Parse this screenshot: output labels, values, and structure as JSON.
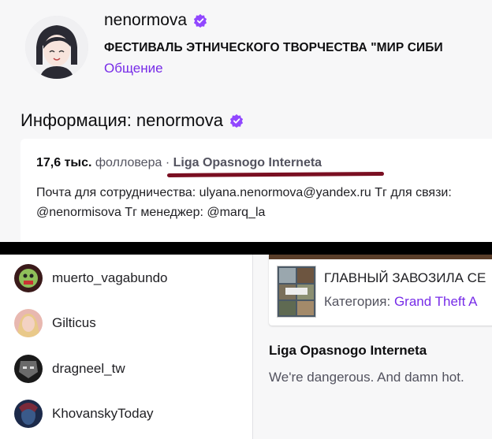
{
  "header": {
    "channel_name": "nenormova",
    "stream_title": "ФЕСТИВАЛЬ ЭТНИЧЕСКОГО ТВОРЧЕСТВА \"МИР СИБИ",
    "category": "Общение",
    "verified_color": "#9147ff"
  },
  "about": {
    "heading": "Информация: nenormova",
    "followers_count": "17,6 тыс.",
    "followers_label": "фолловера",
    "dot": "·",
    "team": "Liga Opasnogo Interneta",
    "bio": "Почта для сотрудничества: ulyana.nenormova@yandex.ru Тг для связи: @nenormisova Тг менеджер: @marq_la"
  },
  "followed_channels": [
    {
      "name": "muerto_vagabundo",
      "icon": "avatar-green-face"
    },
    {
      "name": "Gilticus",
      "icon": "avatar-blonde"
    },
    {
      "name": "dragneel_tw",
      "icon": "avatar-dark-mask"
    },
    {
      "name": "KhovanskyToday",
      "icon": "avatar-blue-dark"
    }
  ],
  "video": {
    "title": "ГЛАВНЫЙ ЗАВОЗИЛА СЕ",
    "category_label": "Категория:",
    "category_value": "Grand Theft A",
    "thumb_icon": "gta-cover"
  },
  "team_card": {
    "name": "Liga Opasnogo Interneta",
    "description": "We're dangerous. And damn hot."
  },
  "colors": {
    "accent": "#772ce8",
    "underline": "#7a0f22",
    "separator": "#000000"
  }
}
